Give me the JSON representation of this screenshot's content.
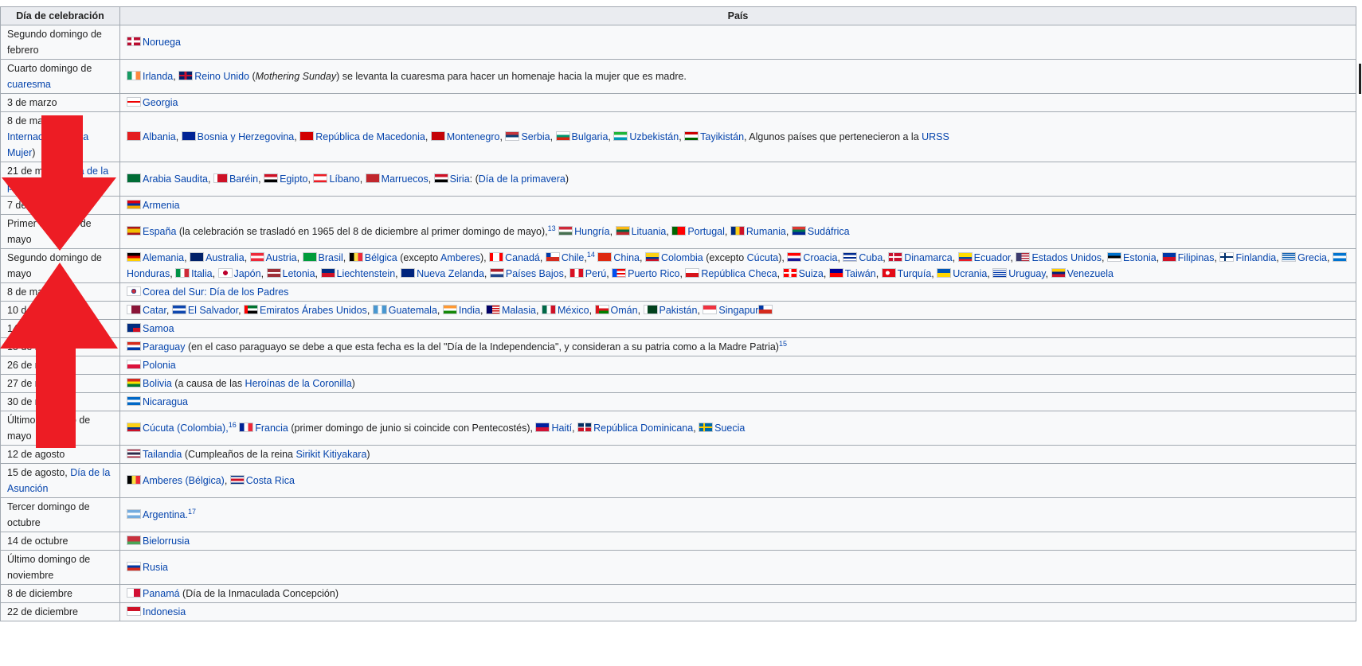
{
  "headers": {
    "day": "Día de celebración",
    "country": "País"
  },
  "arrow_color": "#ed1c24",
  "rows": [
    {
      "day": [
        {
          "t": "Segundo domingo de febrero"
        }
      ],
      "country": [
        {
          "f": "no",
          "l": "Noruega"
        }
      ]
    },
    {
      "day": [
        {
          "t": "Cuarto domingo de "
        },
        {
          "l": "cuaresma"
        }
      ],
      "country": [
        {
          "f": "ie",
          "l": "Irlanda"
        },
        {
          "t": ", "
        },
        {
          "f": "gb",
          "l": "Reino Unido"
        },
        {
          "t": " ("
        },
        {
          "i": "Mothering Sunday"
        },
        {
          "t": ") se levanta la cuaresma para hacer un homenaje hacia la mujer que es madre."
        }
      ]
    },
    {
      "day": [
        {
          "t": "3 de marzo"
        }
      ],
      "country": [
        {
          "f": "ge",
          "l": "Georgia"
        }
      ]
    },
    {
      "day": [
        {
          "t": "8 de marzo ("
        },
        {
          "l": "Día Internacional de la Mujer"
        },
        {
          "t": ")"
        }
      ],
      "country": [
        {
          "f": "al",
          "l": "Albania"
        },
        {
          "t": ", "
        },
        {
          "f": "ba",
          "l": "Bosnia y Herzegovina"
        },
        {
          "t": ", "
        },
        {
          "f": "mk",
          "l": "República de Macedonia"
        },
        {
          "t": ", "
        },
        {
          "f": "me",
          "l": "Montenegro"
        },
        {
          "t": ", "
        },
        {
          "f": "rs",
          "l": "Serbia"
        },
        {
          "t": ", "
        },
        {
          "f": "bg",
          "l": "Bulgaria"
        },
        {
          "t": ", "
        },
        {
          "f": "uz",
          "l": "Uzbekistán"
        },
        {
          "t": ", "
        },
        {
          "f": "tj",
          "l": "Tayikistán"
        },
        {
          "t": ", Algunos países que pertenecieron a la "
        },
        {
          "l": "URSS"
        }
      ]
    },
    {
      "day": [
        {
          "t": "21 de marzo ("
        },
        {
          "l": "Día de la primavera"
        },
        {
          "t": ")"
        }
      ],
      "country": [
        {
          "f": "sa",
          "l": "Arabia Saudita"
        },
        {
          "t": ", "
        },
        {
          "f": "bh",
          "l": "Baréin"
        },
        {
          "t": ", "
        },
        {
          "f": "eg",
          "l": "Egipto"
        },
        {
          "t": ", "
        },
        {
          "f": "lb",
          "l": "Líbano"
        },
        {
          "t": ", "
        },
        {
          "f": "ma",
          "l": "Marruecos"
        },
        {
          "t": ", "
        },
        {
          "f": "sy",
          "l": "Siria"
        },
        {
          "t": ": ("
        },
        {
          "l": "Día de la primavera"
        },
        {
          "t": ")"
        }
      ]
    },
    {
      "day": [
        {
          "t": "7 de abril"
        }
      ],
      "country": [
        {
          "f": "am",
          "l": "Armenia"
        }
      ]
    },
    {
      "day": [
        {
          "t": "Primer domingo de mayo"
        }
      ],
      "country": [
        {
          "f": "es",
          "l": "España"
        },
        {
          "t": " (la celebración se trasladó en 1965 del 8 de diciembre al primer domingo de mayo),"
        },
        {
          "s": "13"
        },
        {
          "t": " "
        },
        {
          "f": "hu",
          "l": "Hungría"
        },
        {
          "t": ", "
        },
        {
          "f": "lt",
          "l": "Lituania"
        },
        {
          "t": ", "
        },
        {
          "f": "pt",
          "l": "Portugal"
        },
        {
          "t": ", "
        },
        {
          "f": "ro",
          "l": "Rumania"
        },
        {
          "t": ", "
        },
        {
          "f": "za",
          "l": "Sudáfrica"
        }
      ]
    },
    {
      "day": [
        {
          "t": "Segundo domingo de mayo"
        }
      ],
      "country": [
        {
          "f": "de",
          "l": "Alemania"
        },
        {
          "t": ", "
        },
        {
          "f": "au",
          "l": "Australia"
        },
        {
          "t": ", "
        },
        {
          "f": "at",
          "l": "Austria"
        },
        {
          "t": ", "
        },
        {
          "f": "br",
          "l": "Brasil"
        },
        {
          "t": ", "
        },
        {
          "f": "be",
          "l": "Bélgica"
        },
        {
          "t": " (excepto "
        },
        {
          "l": "Amberes"
        },
        {
          "t": "), "
        },
        {
          "f": "ca",
          "l": "Canadá"
        },
        {
          "t": ", "
        },
        {
          "f": "cl",
          "l": "Chile"
        },
        {
          "t": ","
        },
        {
          "s": "14"
        },
        {
          "t": " "
        },
        {
          "f": "cn",
          "l": "China"
        },
        {
          "t": ", "
        },
        {
          "f": "co",
          "l": "Colombia"
        },
        {
          "t": " (excepto "
        },
        {
          "l": "Cúcuta"
        },
        {
          "t": "), "
        },
        {
          "f": "hr",
          "l": "Croacia"
        },
        {
          "t": ", "
        },
        {
          "f": "cu",
          "l": "Cuba"
        },
        {
          "t": ", "
        },
        {
          "f": "dk",
          "l": "Dinamarca"
        },
        {
          "t": ", "
        },
        {
          "f": "ec",
          "l": "Ecuador"
        },
        {
          "t": ", "
        },
        {
          "f": "us",
          "l": "Estados Unidos"
        },
        {
          "t": ", "
        },
        {
          "f": "ee",
          "l": "Estonia"
        },
        {
          "t": ", "
        },
        {
          "f": "ph",
          "l": "Filipinas"
        },
        {
          "t": ", "
        },
        {
          "f": "fi",
          "l": "Finlandia"
        },
        {
          "t": ", "
        },
        {
          "f": "gr",
          "l": "Grecia"
        },
        {
          "t": ", "
        },
        {
          "f": "hn",
          "l": "Honduras"
        },
        {
          "t": ", "
        },
        {
          "f": "it",
          "l": "Italia"
        },
        {
          "t": ", "
        },
        {
          "f": "jp",
          "l": "Japón"
        },
        {
          "t": ", "
        },
        {
          "f": "lv",
          "l": "Letonia"
        },
        {
          "t": ", "
        },
        {
          "f": "li",
          "l": "Liechtenstein"
        },
        {
          "t": ", "
        },
        {
          "f": "nz",
          "l": "Nueva Zelanda"
        },
        {
          "t": ", "
        },
        {
          "f": "nl",
          "l": "Países Bajos"
        },
        {
          "t": ", "
        },
        {
          "f": "pe",
          "l": "Perú"
        },
        {
          "t": ", "
        },
        {
          "f": "pr",
          "l": "Puerto Rico"
        },
        {
          "t": ", "
        },
        {
          "f": "cz",
          "l": "República Checa"
        },
        {
          "t": ", "
        },
        {
          "f": "ch",
          "l": "Suiza"
        },
        {
          "t": ", "
        },
        {
          "f": "tw",
          "l": "Taiwán"
        },
        {
          "t": ", "
        },
        {
          "f": "tr",
          "l": "Turquía"
        },
        {
          "t": ", "
        },
        {
          "f": "ua",
          "l": "Ucrania"
        },
        {
          "t": ", "
        },
        {
          "f": "uy",
          "l": "Uruguay"
        },
        {
          "t": ", "
        },
        {
          "f": "ve",
          "l": "Venezuela"
        }
      ]
    },
    {
      "day": [
        {
          "t": "8 de mayo"
        }
      ],
      "country": [
        {
          "f": "kr",
          "l": "Corea del Sur: Día de los Padres"
        }
      ]
    },
    {
      "day": [
        {
          "t": "10 de mayo"
        }
      ],
      "country": [
        {
          "f": "qa",
          "l": "Catar"
        },
        {
          "t": ", "
        },
        {
          "f": "sv",
          "l": "El Salvador"
        },
        {
          "t": ", "
        },
        {
          "f": "ae",
          "l": "Emiratos Árabes Unidos"
        },
        {
          "t": ", "
        },
        {
          "f": "gt",
          "l": "Guatemala"
        },
        {
          "t": ", "
        },
        {
          "f": "in",
          "l": "India"
        },
        {
          "t": ", "
        },
        {
          "f": "my",
          "l": "Malasia"
        },
        {
          "t": ", "
        },
        {
          "f": "mx",
          "l": "México"
        },
        {
          "t": ", "
        },
        {
          "f": "om",
          "l": "Omán"
        },
        {
          "t": ", "
        },
        {
          "f": "pk",
          "l": "Pakistán"
        },
        {
          "t": ", "
        },
        {
          "f": "sg",
          "l": "Singapur"
        },
        {
          "f": "cl"
        }
      ]
    },
    {
      "day": [
        {
          "t": "14 de mayo"
        }
      ],
      "country": [
        {
          "f": "ws",
          "l": "Samoa"
        }
      ]
    },
    {
      "day": [
        {
          "t": "15 de mayo"
        }
      ],
      "country": [
        {
          "f": "py",
          "l": "Paraguay"
        },
        {
          "t": " (en el caso paraguayo se debe a que esta fecha es la del \"Día de la Independencia\", y consideran a su patria como a la Madre Patria)"
        },
        {
          "s": "15"
        }
      ]
    },
    {
      "day": [
        {
          "t": "26 de mayo"
        }
      ],
      "country": [
        {
          "f": "pl",
          "l": "Polonia"
        }
      ]
    },
    {
      "day": [
        {
          "t": "27 de mayo"
        }
      ],
      "country": [
        {
          "f": "bo",
          "l": "Bolivia"
        },
        {
          "t": " (a causa de las "
        },
        {
          "l": "Heroínas de la Coronilla"
        },
        {
          "t": ")"
        }
      ]
    },
    {
      "day": [
        {
          "t": "30 de mayo"
        }
      ],
      "country": [
        {
          "f": "ni",
          "l": "Nicaragua"
        }
      ]
    },
    {
      "day": [
        {
          "t": "Último domingo de mayo"
        }
      ],
      "country": [
        {
          "f": "co",
          "l": "Cúcuta (Colombia),"
        },
        {
          "s": "16"
        },
        {
          "t": " "
        },
        {
          "f": "fr",
          "l": "Francia"
        },
        {
          "t": " (primer domingo de junio si coincide con Pentecostés), "
        },
        {
          "f": "ht",
          "l": "Haití"
        },
        {
          "t": ", "
        },
        {
          "f": "do",
          "l": "República Dominicana"
        },
        {
          "t": ", "
        },
        {
          "f": "se",
          "l": "Suecia"
        }
      ]
    },
    {
      "day": [
        {
          "t": "12 de agosto"
        }
      ],
      "country": [
        {
          "f": "th",
          "l": "Tailandia"
        },
        {
          "t": " (Cumpleaños de la reina "
        },
        {
          "l": "Sirikit Kitiyakara"
        },
        {
          "t": ")"
        }
      ]
    },
    {
      "day": [
        {
          "t": "15 de agosto, "
        },
        {
          "l": "Día de la Asunción"
        }
      ],
      "country": [
        {
          "f": "be",
          "l": "Amberes (Bélgica)"
        },
        {
          "t": ", "
        },
        {
          "f": "cr",
          "l": "Costa Rica"
        }
      ]
    },
    {
      "day": [
        {
          "t": "Tercer domingo de octubre"
        }
      ],
      "country": [
        {
          "f": "ar",
          "l": "Argentina."
        },
        {
          "s": "17"
        }
      ]
    },
    {
      "day": [
        {
          "t": "14 de octubre"
        }
      ],
      "country": [
        {
          "f": "by",
          "l": "Bielorrusia"
        }
      ]
    },
    {
      "day": [
        {
          "t": "Último domingo de noviembre"
        }
      ],
      "country": [
        {
          "f": "ru",
          "l": "Rusia"
        }
      ]
    },
    {
      "day": [
        {
          "t": "8 de diciembre"
        }
      ],
      "country": [
        {
          "f": "pa",
          "l": "Panamá"
        },
        {
          "t": " (Día de la Inmaculada Concepción)"
        }
      ]
    },
    {
      "day": [
        {
          "t": "22 de diciembre"
        }
      ],
      "country": [
        {
          "f": "id",
          "l": "Indonesia"
        }
      ]
    }
  ]
}
